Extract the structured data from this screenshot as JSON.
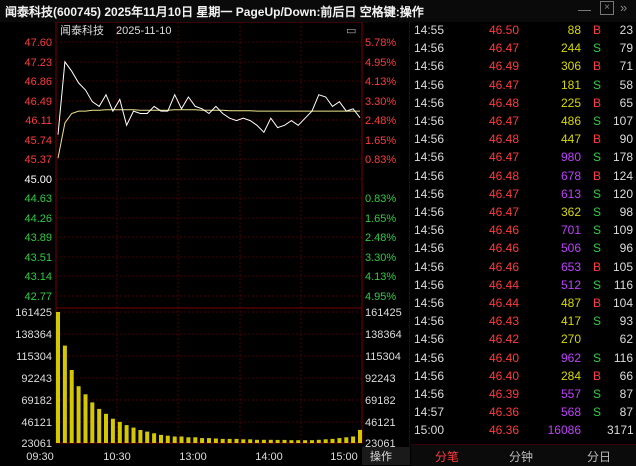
{
  "window": {
    "title": "闻泰科技(600745)  2025年11月10日 星期一  PageUp/Down:前后日 空格键:操作",
    "minimize_glyph": "—",
    "close_glyph": "×",
    "more_glyph": "»"
  },
  "chart": {
    "header_name": "闻泰科技",
    "header_date": "2025-11-10",
    "settings_glyph": "▭",
    "prev_close": "45.00",
    "price_labels_up": [
      "47.60",
      "47.23",
      "46.86",
      "46.49",
      "46.11",
      "45.74",
      "45.37"
    ],
    "price_labels_down": [
      "44.63",
      "44.26",
      "43.89",
      "43.51",
      "43.14",
      "42.77"
    ],
    "pct_labels_up": [
      "5.78%",
      "4.95%",
      "4.13%",
      "3.30%",
      "2.48%",
      "1.65%",
      "0.83%"
    ],
    "pct_labels_down": [
      "0.83%",
      "1.65%",
      "2.48%",
      "3.30%",
      "4.13%",
      "4.95%"
    ],
    "volume_labels": [
      "161425",
      "138364",
      "115304",
      "92243",
      "69182",
      "46121",
      "23061"
    ],
    "time_labels": [
      "09:30",
      "10:30",
      "13:00",
      "14:00",
      "15:00"
    ],
    "operate_label": "操作",
    "colors": {
      "up": "#ff3b3b",
      "down": "#2ecc40",
      "volume": "#d6c800",
      "avg_line": "#f0e68c",
      "price_line": "#ffffff",
      "grid": "#5a0000"
    }
  },
  "chart_data": {
    "type": "line",
    "price_series": [
      46.0,
      47.55,
      47.35,
      47.1,
      46.95,
      46.7,
      46.6,
      46.85,
      46.5,
      46.75,
      46.2,
      46.5,
      46.45,
      46.45,
      46.6,
      46.5,
      46.5,
      46.85,
      46.55,
      46.8,
      46.6,
      46.55,
      46.45,
      46.6,
      46.45,
      46.35,
      46.3,
      46.35,
      46.3,
      46.2,
      46.05,
      46.35,
      46.15,
      46.2,
      46.3,
      46.2,
      46.35,
      46.5,
      46.85,
      46.8,
      46.6,
      46.7,
      46.5,
      46.55,
      46.36
    ],
    "avg_series": [
      45.5,
      46.25,
      46.45,
      46.5,
      46.5,
      46.52,
      46.52,
      46.53,
      46.53,
      46.53,
      46.53,
      46.53,
      46.52,
      46.52,
      46.52,
      46.52,
      46.52,
      46.53,
      46.53,
      46.53,
      46.53,
      46.52,
      46.52,
      46.52,
      46.52,
      46.51,
      46.51,
      46.51,
      46.51,
      46.5,
      46.5,
      46.5,
      46.5,
      46.5,
      46.5,
      46.5,
      46.5,
      46.5,
      46.5,
      46.5,
      46.5,
      46.5,
      46.5,
      46.5,
      46.5
    ],
    "volume_series": [
      161425,
      120000,
      90000,
      70000,
      60000,
      50000,
      42000,
      36000,
      30000,
      26000,
      22000,
      19000,
      16000,
      14000,
      12000,
      10000,
      9000,
      8000,
      8000,
      7000,
      7000,
      6000,
      6000,
      5500,
      5000,
      5000,
      5000,
      4500,
      4500,
      4000,
      4000,
      4000,
      3800,
      3800,
      3500,
      3500,
      3500,
      3500,
      4000,
      4500,
      5000,
      6000,
      7000,
      8000,
      16086
    ],
    "y_range": [
      42.4,
      47.97
    ],
    "prev_close": 45.0,
    "volume_max": 161425
  },
  "ticks": [
    {
      "time": "14:55",
      "price": "46.50",
      "vol": "88",
      "side": "B",
      "count": "23",
      "color": "#d8d800"
    },
    {
      "time": "14:56",
      "price": "46.47",
      "vol": "244",
      "side": "S",
      "count": "79",
      "color": "#d8d800"
    },
    {
      "time": "14:56",
      "price": "46.49",
      "vol": "306",
      "side": "B",
      "count": "71",
      "color": "#d8d800"
    },
    {
      "time": "14:56",
      "price": "46.47",
      "vol": "181",
      "side": "S",
      "count": "58",
      "color": "#d8d800"
    },
    {
      "time": "14:56",
      "price": "46.48",
      "vol": "225",
      "side": "B",
      "count": "65",
      "color": "#d8d800"
    },
    {
      "time": "14:56",
      "price": "46.47",
      "vol": "486",
      "side": "S",
      "count": "107",
      "color": "#d8d800"
    },
    {
      "time": "14:56",
      "price": "46.48",
      "vol": "447",
      "side": "B",
      "count": "90",
      "color": "#d8d800"
    },
    {
      "time": "14:56",
      "price": "46.47",
      "vol": "980",
      "side": "S",
      "count": "178",
      "color": "#c040ff"
    },
    {
      "time": "14:56",
      "price": "46.48",
      "vol": "678",
      "side": "B",
      "count": "124",
      "color": "#c040ff"
    },
    {
      "time": "14:56",
      "price": "46.47",
      "vol": "613",
      "side": "S",
      "count": "120",
      "color": "#c040ff"
    },
    {
      "time": "14:56",
      "price": "46.47",
      "vol": "362",
      "side": "S",
      "count": "98",
      "color": "#d8d800"
    },
    {
      "time": "14:56",
      "price": "46.46",
      "vol": "701",
      "side": "S",
      "count": "109",
      "color": "#c040ff"
    },
    {
      "time": "14:56",
      "price": "46.46",
      "vol": "506",
      "side": "S",
      "count": "96",
      "color": "#c040ff"
    },
    {
      "time": "14:56",
      "price": "46.46",
      "vol": "653",
      "side": "B",
      "count": "105",
      "color": "#c040ff"
    },
    {
      "time": "14:56",
      "price": "46.44",
      "vol": "512",
      "side": "S",
      "count": "116",
      "color": "#c040ff"
    },
    {
      "time": "14:56",
      "price": "46.44",
      "vol": "487",
      "side": "B",
      "count": "104",
      "color": "#d8d800"
    },
    {
      "time": "14:56",
      "price": "46.43",
      "vol": "417",
      "side": "S",
      "count": "93",
      "color": "#d8d800"
    },
    {
      "time": "14:56",
      "price": "46.42",
      "vol": "270",
      "side": "",
      "count": "62",
      "color": "#d8d800"
    },
    {
      "time": "14:56",
      "price": "46.40",
      "vol": "962",
      "side": "S",
      "count": "116",
      "color": "#c040ff"
    },
    {
      "time": "14:56",
      "price": "46.40",
      "vol": "284",
      "side": "B",
      "count": "66",
      "color": "#d8d800"
    },
    {
      "time": "14:56",
      "price": "46.39",
      "vol": "557",
      "side": "S",
      "count": "87",
      "color": "#c040ff"
    },
    {
      "time": "14:57",
      "price": "46.36",
      "vol": "568",
      "side": "S",
      "count": "87",
      "color": "#c040ff"
    },
    {
      "time": "15:00",
      "price": "46.36",
      "vol": "16086",
      "side": "",
      "count": "3171",
      "color": "#c040ff"
    }
  ],
  "tabs": {
    "ticks": "分笔",
    "minute": "分钟",
    "day": "分日"
  }
}
